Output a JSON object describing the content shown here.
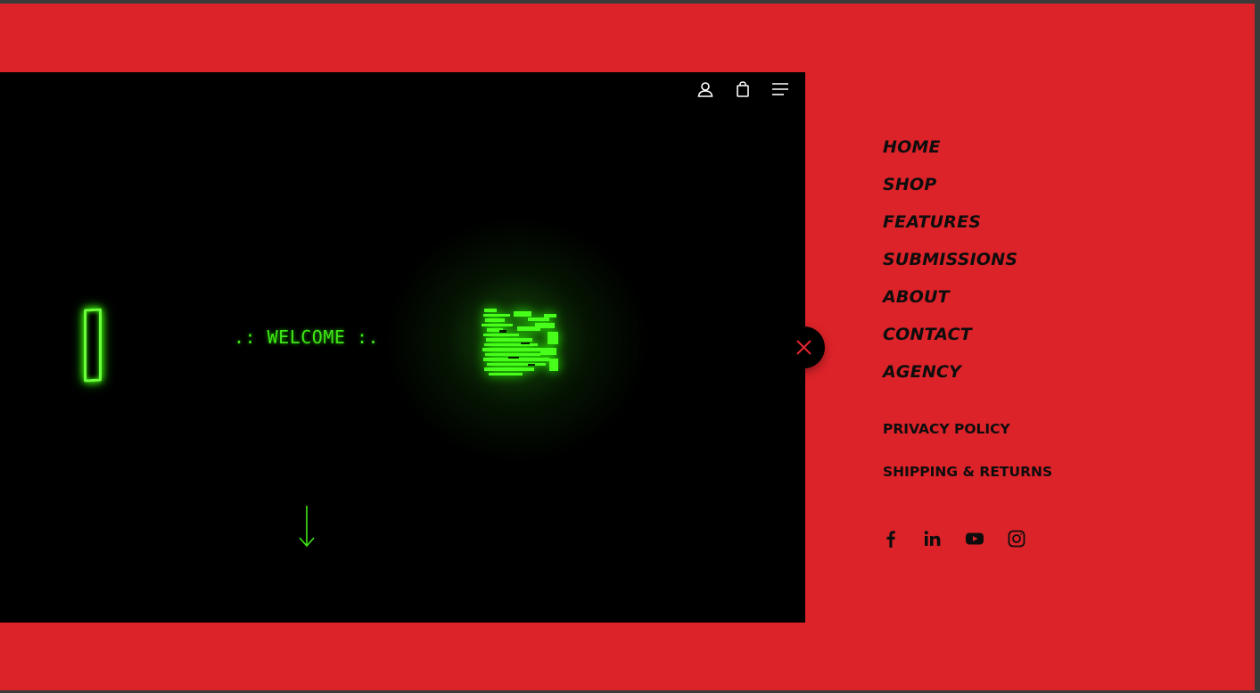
{
  "hero": {
    "welcome_text": ".: WELCOME :.",
    "header_icons": [
      {
        "name": "user-account-icon"
      },
      {
        "name": "shopping-bag-icon"
      },
      {
        "name": "hamburger-menu-icon"
      }
    ],
    "accent_color": "#3fe814"
  },
  "offcanvas": {
    "background_color": "#dc2329",
    "close_icon": "close-icon",
    "main_menu": [
      {
        "label": "HOME"
      },
      {
        "label": "SHOP"
      },
      {
        "label": "FEATURES"
      },
      {
        "label": "SUBMISSIONS"
      },
      {
        "label": "ABOUT"
      },
      {
        "label": "CONTACT"
      },
      {
        "label": "AGENCY"
      }
    ],
    "secondary_menu": [
      {
        "label": "PRIVACY POLICY"
      },
      {
        "label": "SHIPPING & RETURNS"
      }
    ],
    "social_icons": [
      {
        "name": "facebook-icon"
      },
      {
        "name": "linkedin-icon"
      },
      {
        "name": "youtube-icon"
      },
      {
        "name": "instagram-icon"
      }
    ]
  }
}
